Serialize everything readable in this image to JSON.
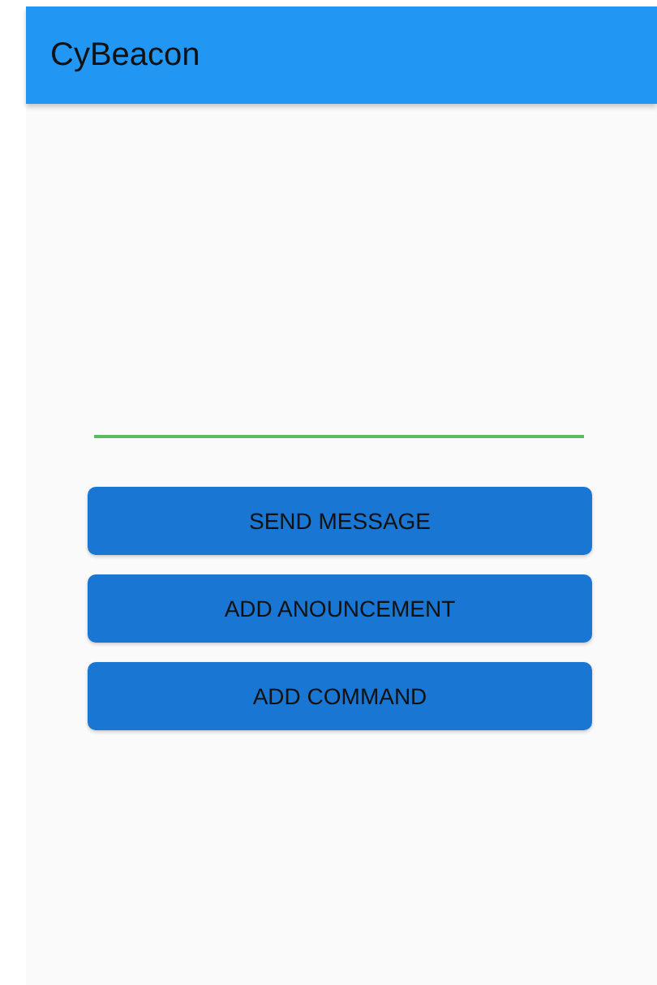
{
  "app_bar": {
    "title": "CyBeacon"
  },
  "buttons": [
    {
      "label": "SEND MESSAGE"
    },
    {
      "label": "ADD ANOUNCEMENT"
    },
    {
      "label": "ADD COMMAND"
    }
  ]
}
